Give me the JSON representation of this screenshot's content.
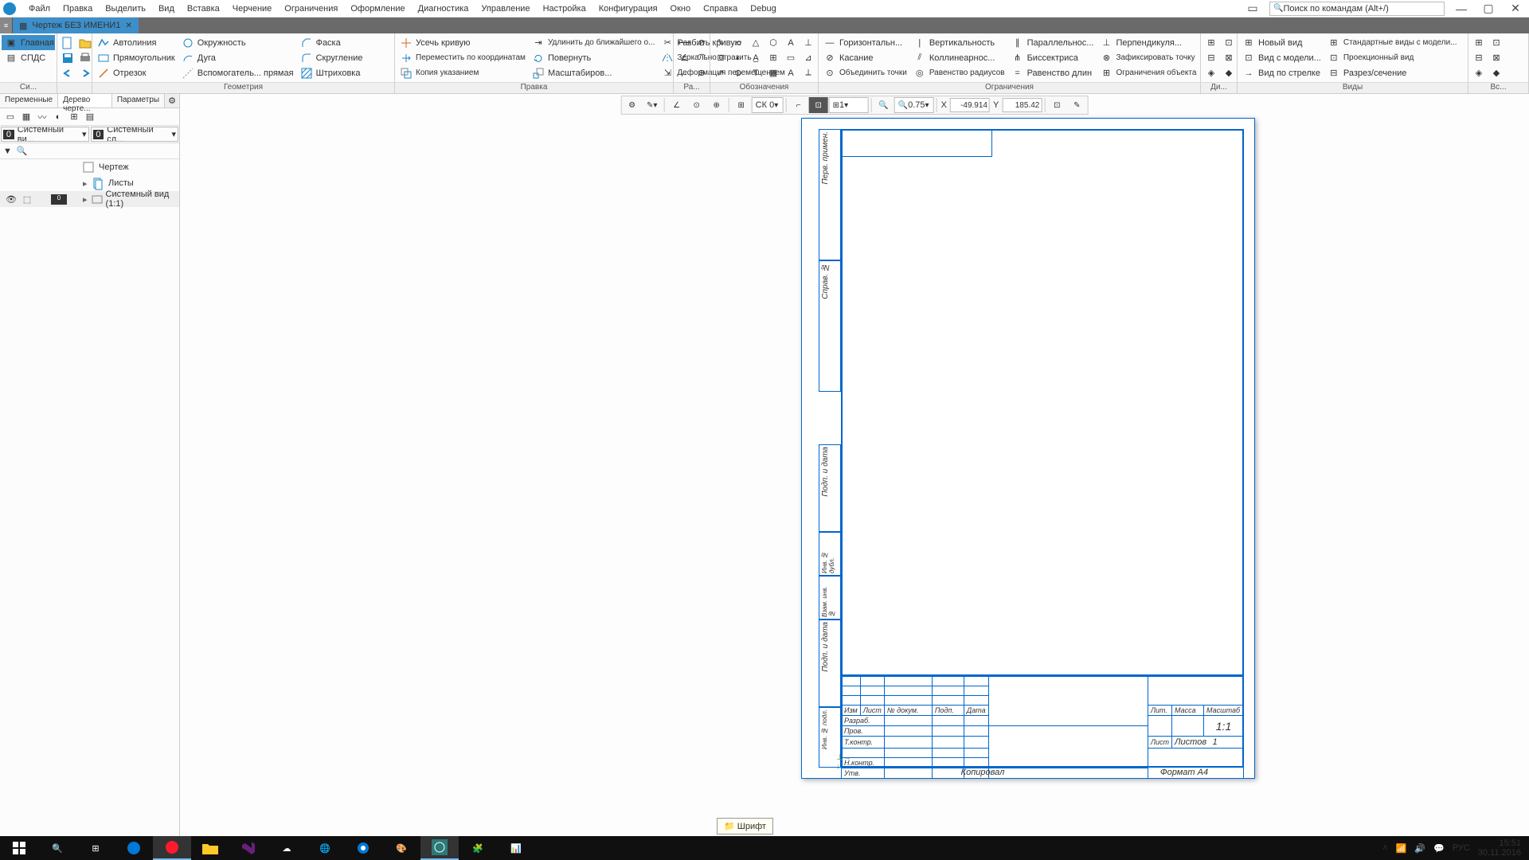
{
  "menu": [
    "Файл",
    "Правка",
    "Выделить",
    "Вид",
    "Вставка",
    "Черчение",
    "Ограничения",
    "Оформление",
    "Диагностика",
    "Управление",
    "Настройка",
    "Конфигурация",
    "Окно",
    "Справка",
    "Debug"
  ],
  "search_placeholder": "Поиск по командам (Alt+/)",
  "doc_tab": "Чертеж БЕЗ ИМЕНИ1",
  "ribbon": {
    "g1_main": "Главная",
    "g1_spds": "СПДС",
    "g1_label": "Си...",
    "g2": {
      "label": "Геометрия",
      "items": [
        "Автолиния",
        "Прямоугольник",
        "Отрезок",
        "Окружность",
        "Дуга",
        "Вспомогатель... прямая",
        "Фаска",
        "Скругление",
        "Штриховка"
      ]
    },
    "g3": {
      "label": "Правка",
      "items": [
        "Усечь кривую",
        "Переместить по координатам",
        "Копия указанием",
        "Удлинить до ближайшего о...",
        "Повернуть",
        "Масштабиров...",
        "Разбить кривую",
        "Зеркально отразить",
        "Деформация перемещением"
      ]
    },
    "g4": {
      "label": "Ра..."
    },
    "g5": {
      "label": "Обозначения"
    },
    "g6": {
      "label": "Ограничения",
      "items": [
        "Горизонтальн...",
        "Касание",
        "Объединить точки",
        "Вертикальность",
        "Коллинеарнос...",
        "Равенство радиусов",
        "Параллельнос...",
        "Биссектриса",
        "Равенство длин",
        "Перпендикуля...",
        "Зафиксировать точку",
        "Ограничения объекта"
      ]
    },
    "g7": {
      "label": "Ди..."
    },
    "g8": {
      "label": "Виды",
      "items": [
        "Новый вид",
        "Вид с модели...",
        "Вид по стрелке",
        "Стандартные виды с модели...",
        "Проекционный вид",
        "Разрез/сечение"
      ]
    },
    "g9": {
      "label": "Вс..."
    }
  },
  "panel_tabs": [
    "Переменные",
    "Дерево черте...",
    "Параметры"
  ],
  "drop1": "Системный ви...",
  "drop2": "Системный сл...",
  "tree": {
    "root": "Чертеж",
    "sheets": "Листы",
    "sysview": "Системный вид (1:1)"
  },
  "ctoolbar": {
    "ck": "СК 0",
    "step": "1",
    "zoom": "0.75",
    "x": "-49.914",
    "y": "185.42"
  },
  "titleblock": {
    "row_labels": [
      "Изм",
      "Лист",
      "№ докум.",
      "Подп.",
      "Дата"
    ],
    "rows": [
      "Разраб.",
      "Пров.",
      "Т.контр.",
      "",
      "Н.контр.",
      "Утв."
    ],
    "lit": "Лит.",
    "massa": "Масса",
    "mashtab": "Масштаб",
    "scale": "1:1",
    "list": "Лист",
    "listov": "Листов",
    "listov_n": "1",
    "side": [
      "Перв. примен.",
      "Справ. №",
      "Подп. и дата",
      "Инв. № дубл.",
      "Взам. инв. №",
      "Подп. и дата",
      "Инв. № подл."
    ],
    "kopiroval": "Копировал",
    "format": "Формат   А4"
  },
  "tooltip": "Шрифт",
  "tray": {
    "lang": "РУС",
    "time": "15:51",
    "date": "30.11.2016"
  }
}
